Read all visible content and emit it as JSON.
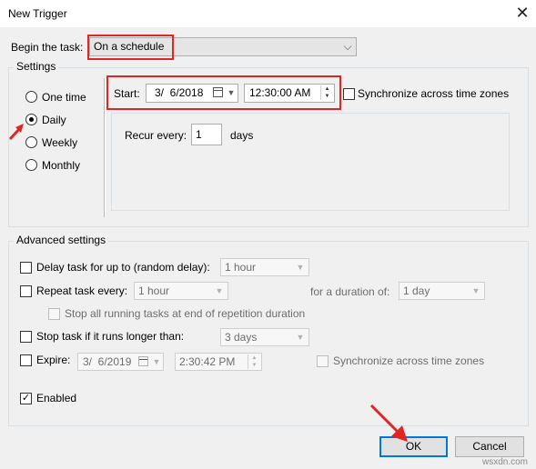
{
  "window": {
    "title": "New Trigger",
    "close_glyph": "✕"
  },
  "begin": {
    "label": "Begin the task:",
    "value": "On a schedule"
  },
  "settings": {
    "legend": "Settings",
    "radios": [
      {
        "label": "One time",
        "checked": false
      },
      {
        "label": "Daily",
        "checked": true
      },
      {
        "label": "Weekly",
        "checked": false
      },
      {
        "label": "Monthly",
        "checked": false
      }
    ],
    "start_label": "Start:",
    "start_date": "3/  6/2018",
    "start_time": "12:30:00 AM",
    "sync_label": "Synchronize across time zones",
    "recur_label": "Recur every:",
    "recur_value": "1",
    "recur_unit": "days"
  },
  "advanced": {
    "legend": "Advanced settings",
    "delay_label": "Delay task for up to (random delay):",
    "delay_value": "1 hour",
    "repeat_label": "Repeat task every:",
    "repeat_value": "1 hour",
    "duration_label": "for a duration of:",
    "duration_value": "1 day",
    "stop_all_label": "Stop all running tasks at end of repetition duration",
    "stop_label": "Stop task if it runs longer than:",
    "stop_value": "3 days",
    "expire_label": "Expire:",
    "expire_date": "3/  6/2019",
    "expire_time": "2:30:42 PM",
    "expire_sync_label": "Synchronize across time zones",
    "enabled_label": "Enabled",
    "check_glyph": "✓"
  },
  "buttons": {
    "ok": "OK",
    "cancel": "Cancel"
  },
  "watermark": "wsxdn.com",
  "colors": {
    "highlight": "#e02525",
    "accent": "#0078d7"
  }
}
